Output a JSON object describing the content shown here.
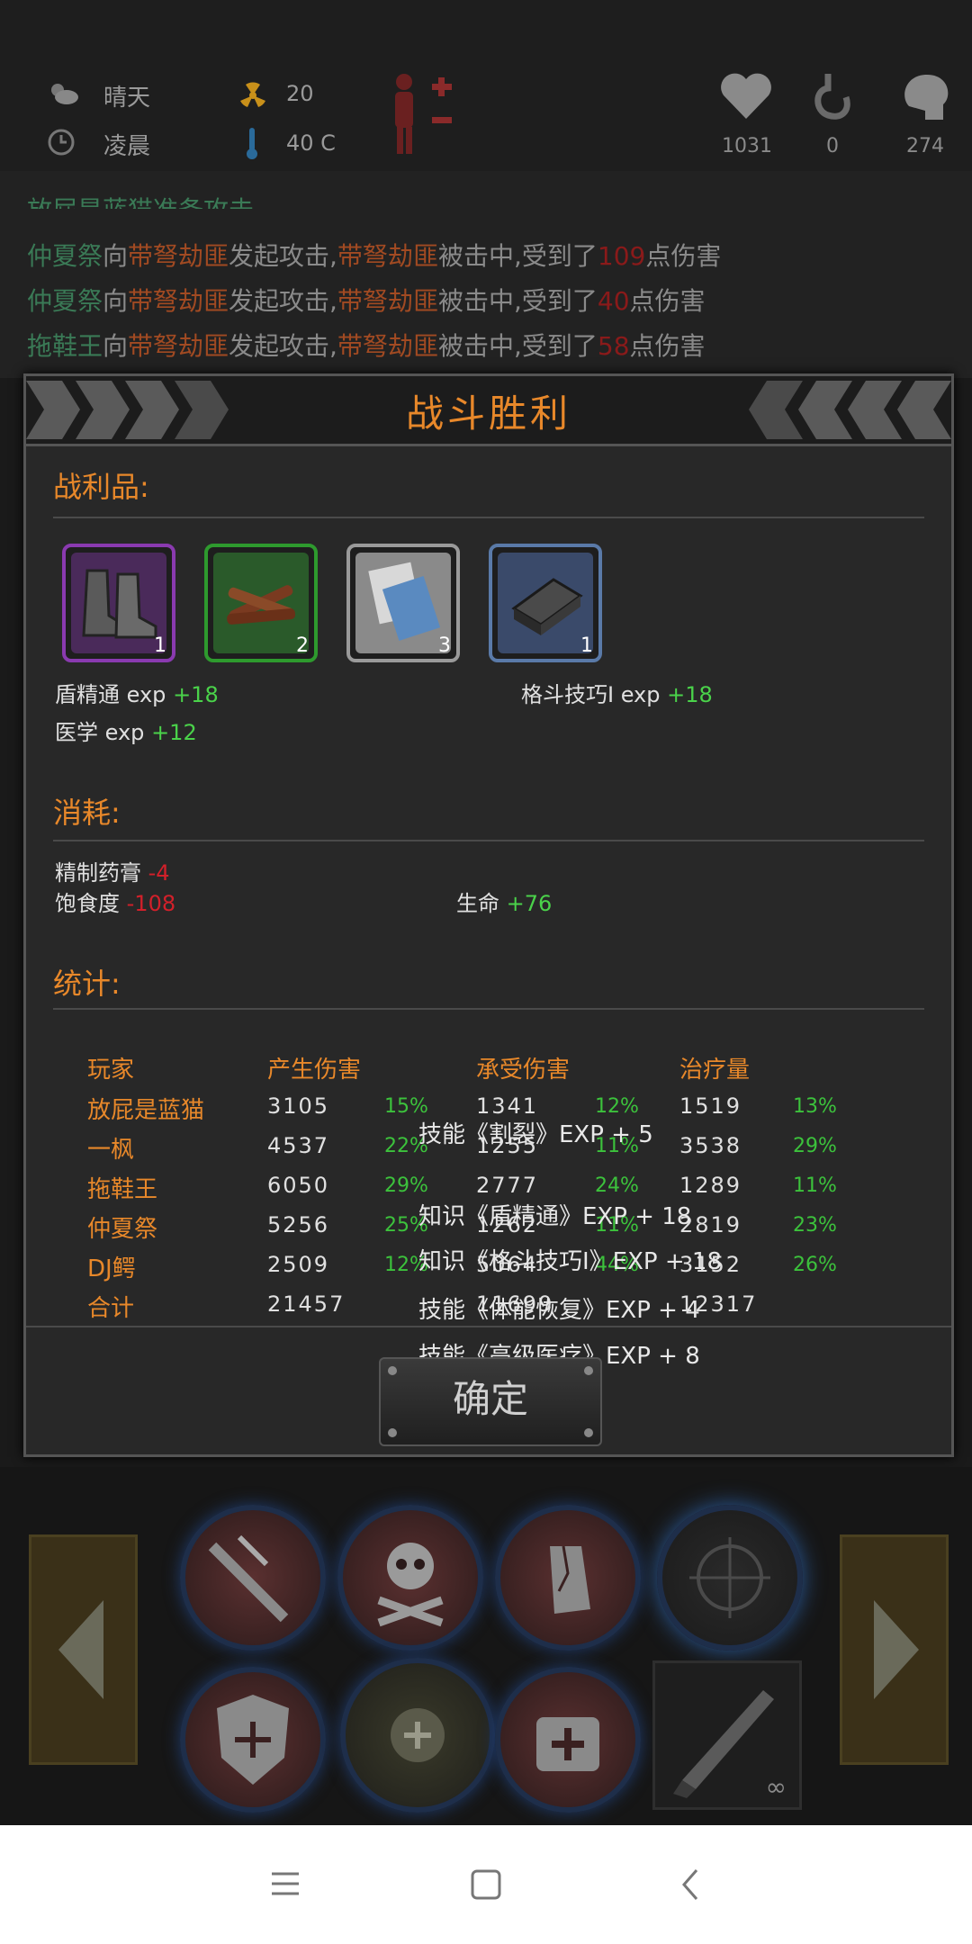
{
  "status": {
    "weather": "晴天",
    "time_of_day": "凌晨",
    "radiation": "20",
    "temperature": "40 C",
    "health": "1031",
    "hunger": "0",
    "sanity": "274",
    "icons": [
      "weather-sun-icon",
      "clock-icon",
      "radiation-icon",
      "thermometer-icon",
      "body-status-icon",
      "heart-icon",
      "stomach-icon",
      "brain-icon"
    ]
  },
  "log": {
    "partial_top": "放屁是蓝猫准备攻击",
    "lines": [
      {
        "attacker": "仲夏祭",
        "verb1": "向",
        "enemy1": "带弩劫匪",
        "verb2": "发起攻击,",
        "enemy2": "带弩劫匪",
        "verb3": "被击中,受到了",
        "damage": "109",
        "suffix": "点伤害"
      },
      {
        "attacker": "仲夏祭",
        "verb1": "向",
        "enemy1": "带弩劫匪",
        "verb2": "发起攻击,",
        "enemy2": "带弩劫匪",
        "verb3": "被击中,受到了",
        "damage": "40",
        "suffix": "点伤害"
      },
      {
        "attacker": "拖鞋王",
        "verb1": "向",
        "enemy1": "带弩劫匪",
        "verb2": "发起攻击,",
        "enemy2": "带弩劫匪",
        "verb3": "被击中,受到了",
        "damage": "58",
        "suffix": "点伤害"
      }
    ]
  },
  "dialog": {
    "title": "战斗胜利",
    "loot_title": "战利品:",
    "loot": [
      {
        "icon": "boots-icon",
        "count": "1",
        "rarity_color": "#8a3ab0"
      },
      {
        "icon": "firewood-icon",
        "count": "2",
        "rarity_color": "#2e9a2e"
      },
      {
        "icon": "cloth-icon",
        "count": "3",
        "rarity_color": "#9a9a9a"
      },
      {
        "icon": "metal-bar-icon",
        "count": "1",
        "rarity_color": "#5a7aa8"
      }
    ],
    "exp": [
      {
        "label": "盾精通 exp",
        "value": "+18"
      },
      {
        "label": "格斗技巧Ⅰ exp",
        "value": "+18"
      },
      {
        "label": "医学 exp",
        "value": "+12"
      }
    ],
    "consume_title": "消耗:",
    "consume": [
      {
        "label": "精制药膏",
        "value": "-4"
      },
      {
        "label": "饱食度",
        "value": "-108"
      },
      {
        "label": "生命",
        "value": "+76"
      }
    ],
    "stats_title": "统计:",
    "table_headers": [
      "玩家",
      "产生伤害",
      "承受伤害",
      "治疗量"
    ],
    "table_rows": [
      {
        "name": "放屁是蓝猫",
        "dmg": "3105",
        "dmg_pct": "15%",
        "taken": "1341",
        "taken_pct": "12%",
        "heal": "1519",
        "heal_pct": "13%"
      },
      {
        "name": "一枫",
        "dmg": "4537",
        "dmg_pct": "22%",
        "taken": "1255",
        "taken_pct": "11%",
        "heal": "3538",
        "heal_pct": "29%"
      },
      {
        "name": "拖鞋王",
        "dmg": "6050",
        "dmg_pct": "29%",
        "taken": "2777",
        "taken_pct": "24%",
        "heal": "1289",
        "heal_pct": "11%"
      },
      {
        "name": "仲夏祭",
        "dmg": "5256",
        "dmg_pct": "25%",
        "taken": "1262",
        "taken_pct": "11%",
        "heal": "2819",
        "heal_pct": "23%"
      },
      {
        "name": "DJ鳄",
        "dmg": "2509",
        "dmg_pct": "12%",
        "taken": "5064",
        "taken_pct": "44%",
        "heal": "3152",
        "heal_pct": "26%"
      }
    ],
    "total": {
      "name": "合计",
      "dmg": "21457",
      "taken": "11699",
      "heal": "12317"
    },
    "skill_popups": [
      "技能《割裂》EXP + 5",
      "知识《盾精通》EXP + 18",
      "知识《格斗技巧Ⅰ》EXP + 18",
      "技能《体能恢复》EXP + 4",
      "技能《高级医疗》EXP + 8"
    ],
    "confirm_label": "确定"
  },
  "actions": {
    "top_row": [
      "attack-slash-icon",
      "skull-crossbones-icon",
      "shatter-icon",
      "crosshair-icon"
    ],
    "bottom_row": [
      "shield-icon",
      "heal-group-icon",
      "medkit-icon",
      "machete-icon"
    ],
    "weapon_durability": "∞"
  },
  "navbar": {
    "icons": [
      "menu-icon",
      "home-icon",
      "back-icon"
    ]
  }
}
